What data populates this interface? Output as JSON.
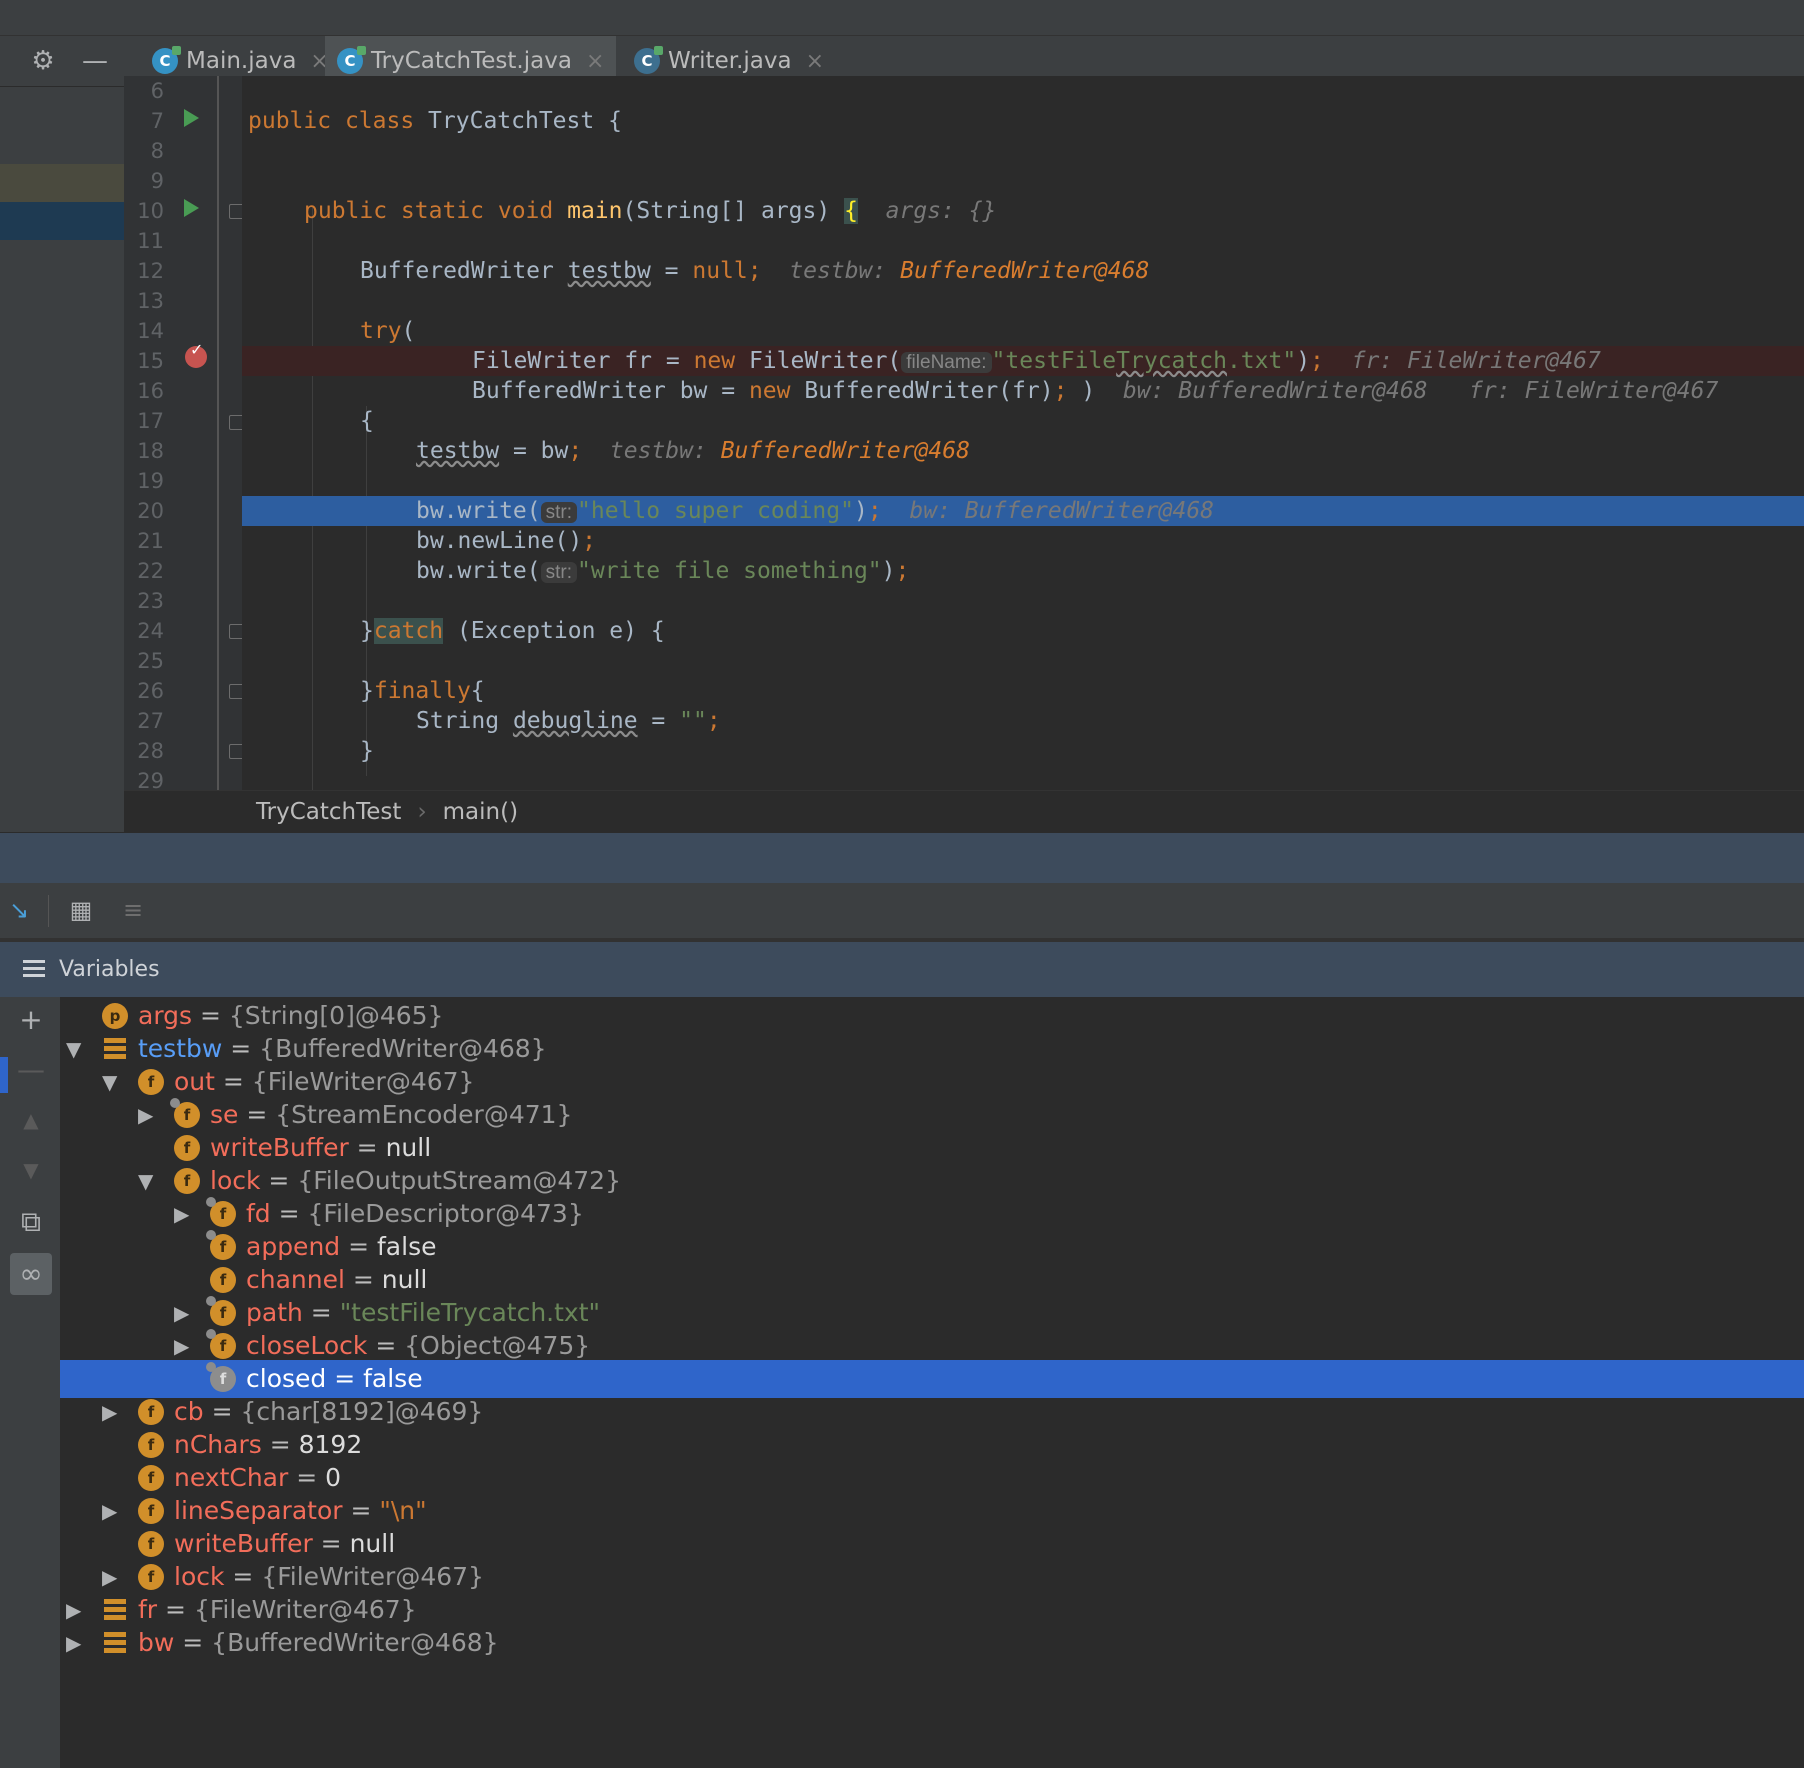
{
  "tabs": [
    {
      "label": "Main.java",
      "close": "×"
    },
    {
      "label": "TryCatchTest.java",
      "close": "×",
      "active": true
    },
    {
      "label": "Writer.java",
      "close": "×"
    }
  ],
  "tab_icons": {
    "settings": "⚙",
    "minimize": "—",
    "file_icon_letter": "C"
  },
  "editor": {
    "line_numbers": [
      "6",
      "7",
      "8",
      "9",
      "10",
      "11",
      "12",
      "13",
      "14",
      "15",
      "16",
      "17",
      "18",
      "19",
      "20",
      "21",
      "22",
      "23",
      "24",
      "25",
      "26",
      "27",
      "28",
      "29"
    ],
    "l7": {
      "kw1": "public",
      "kw2": "class",
      "rest": " TryCatchTest {"
    },
    "l10": {
      "kw": "public static void",
      "fn": "main",
      "params": "(String[] args) ",
      "brace": "{",
      "inline": "args: {}"
    },
    "l12": {
      "type": "BufferedWriter ",
      "var": "testbw",
      "mid": " = ",
      "kw": "null",
      "semi": ";",
      "inl_label": "testbw: ",
      "inl_val": "BufferedWriter@468"
    },
    "l14": {
      "kw": "try",
      "rest": "("
    },
    "l15": {
      "a": "FileWriter fr = ",
      "kw": "new",
      "b": " FileWriter(",
      "hint": "fileName:",
      "str1": "\"testFile",
      "strw": "Trycatch",
      "str2": ".txt\"",
      "c": ")",
      "semi": ";",
      "inl": "fr: FileWriter@467"
    },
    "l16": {
      "a": "BufferedWriter bw = ",
      "kw": "new",
      "b": " BufferedWriter(fr)",
      "semi": ";",
      "c": " )",
      "inl": "bw: BufferedWriter@468   fr: FileWriter@467"
    },
    "l17": {
      "text": "{"
    },
    "l18": {
      "var": "testbw",
      "mid": " = bw",
      "semi": ";",
      "inl_label": "testbw: ",
      "inl_val": "BufferedWriter@468"
    },
    "l20": {
      "a": "bw.write(",
      "hint": "str:",
      "str": "\"hello super coding\"",
      "b": ")",
      "semi": ";",
      "inl": "bw: BufferedWriter@468"
    },
    "l21": {
      "a": "bw.newLine()",
      "semi": ";"
    },
    "l22": {
      "a": "bw.write(",
      "hint": "str:",
      "str": "\"write file something\"",
      "b": ")",
      "semi": ";"
    },
    "l24": {
      "a": "}",
      "kw": "catch",
      "b": " (Exception e) {"
    },
    "l26": {
      "a": "}",
      "kw": "finally",
      "b": "{"
    },
    "l27": {
      "a": "String ",
      "var": "debugline",
      "mid": " = ",
      "str": "\"\"",
      "semi": ";"
    },
    "l28": {
      "a": "}"
    }
  },
  "breadcrumb": {
    "class_name": "TryCatchTest",
    "sep": "›",
    "method": "main()"
  },
  "debug_toolbar": {
    "btn1": "↘",
    "btn2": "▦",
    "btn3": "≡"
  },
  "variables": {
    "header": "Variables",
    "side_buttons": {
      "add": "+",
      "remove": "—",
      "up": "▲",
      "down": "▼",
      "copy": "⧉",
      "watch": "∞"
    },
    "rows": [
      {
        "icon": "p",
        "name": "args",
        "eq": " = ",
        "value": "{String[0]@465}"
      },
      {
        "twisty": "▼",
        "icon": "list",
        "name": "testbw",
        "eq": " = ",
        "value": "{BufferedWriter@468}"
      },
      {
        "twisty": "▼",
        "icon": "f",
        "name": "out",
        "eq": " = ",
        "value": "{FileWriter@467}"
      },
      {
        "twisty": "▶",
        "icon": "f",
        "name": "se",
        "eq": " = ",
        "value": "{StreamEncoder@471}"
      },
      {
        "icon": "f",
        "name": "writeBuffer",
        "eq": " = ",
        "value": "null"
      },
      {
        "twisty": "▼",
        "icon": "f",
        "name": "lock",
        "eq": " = ",
        "value": "{FileOutputStream@472}"
      },
      {
        "twisty": "▶",
        "icon": "f",
        "name": "fd",
        "eq": " = ",
        "value": "{FileDescriptor@473}"
      },
      {
        "icon": "f",
        "name": "append",
        "eq": " = ",
        "value": "false"
      },
      {
        "icon": "f",
        "name": "channel",
        "eq": " = ",
        "value": "null"
      },
      {
        "twisty": "▶",
        "icon": "f",
        "name": "path",
        "eq": " = ",
        "value": "\"testFileTrycatch.txt\""
      },
      {
        "twisty": "▶",
        "icon": "f",
        "name": "closeLock",
        "eq": " = ",
        "value": "{Object@475}"
      },
      {
        "icon": "f",
        "name": "closed",
        "eq": " = ",
        "value": "false",
        "selected": true
      },
      {
        "twisty": "▶",
        "icon": "f",
        "name": "cb",
        "eq": " = ",
        "value": "{char[8192]@469}"
      },
      {
        "icon": "f",
        "name": "nChars",
        "eq": " = ",
        "value": "8192"
      },
      {
        "icon": "f",
        "name": "nextChar",
        "eq": " = ",
        "value": "0"
      },
      {
        "twisty": "▶",
        "icon": "f",
        "name": "lineSeparator",
        "eq": " = ",
        "value": "\"\\n\""
      },
      {
        "icon": "f",
        "name": "writeBuffer",
        "eq": " = ",
        "value": "null"
      },
      {
        "twisty": "▶",
        "icon": "f",
        "name": "lock",
        "eq": " = ",
        "value": "{FileWriter@467}"
      },
      {
        "twisty": "▶",
        "icon": "list",
        "name": "fr",
        "eq": " = ",
        "value": "{FileWriter@467}"
      },
      {
        "twisty": "▶",
        "icon": "list",
        "name": "bw",
        "eq": " = ",
        "value": "{BufferedWriter@468}"
      }
    ]
  },
  "colors": {
    "accent": "#2f65ca",
    "keyword": "#cc7832",
    "string": "#6a8759",
    "field_name": "#f26d5a",
    "execution_line": "#2d5ea0"
  }
}
